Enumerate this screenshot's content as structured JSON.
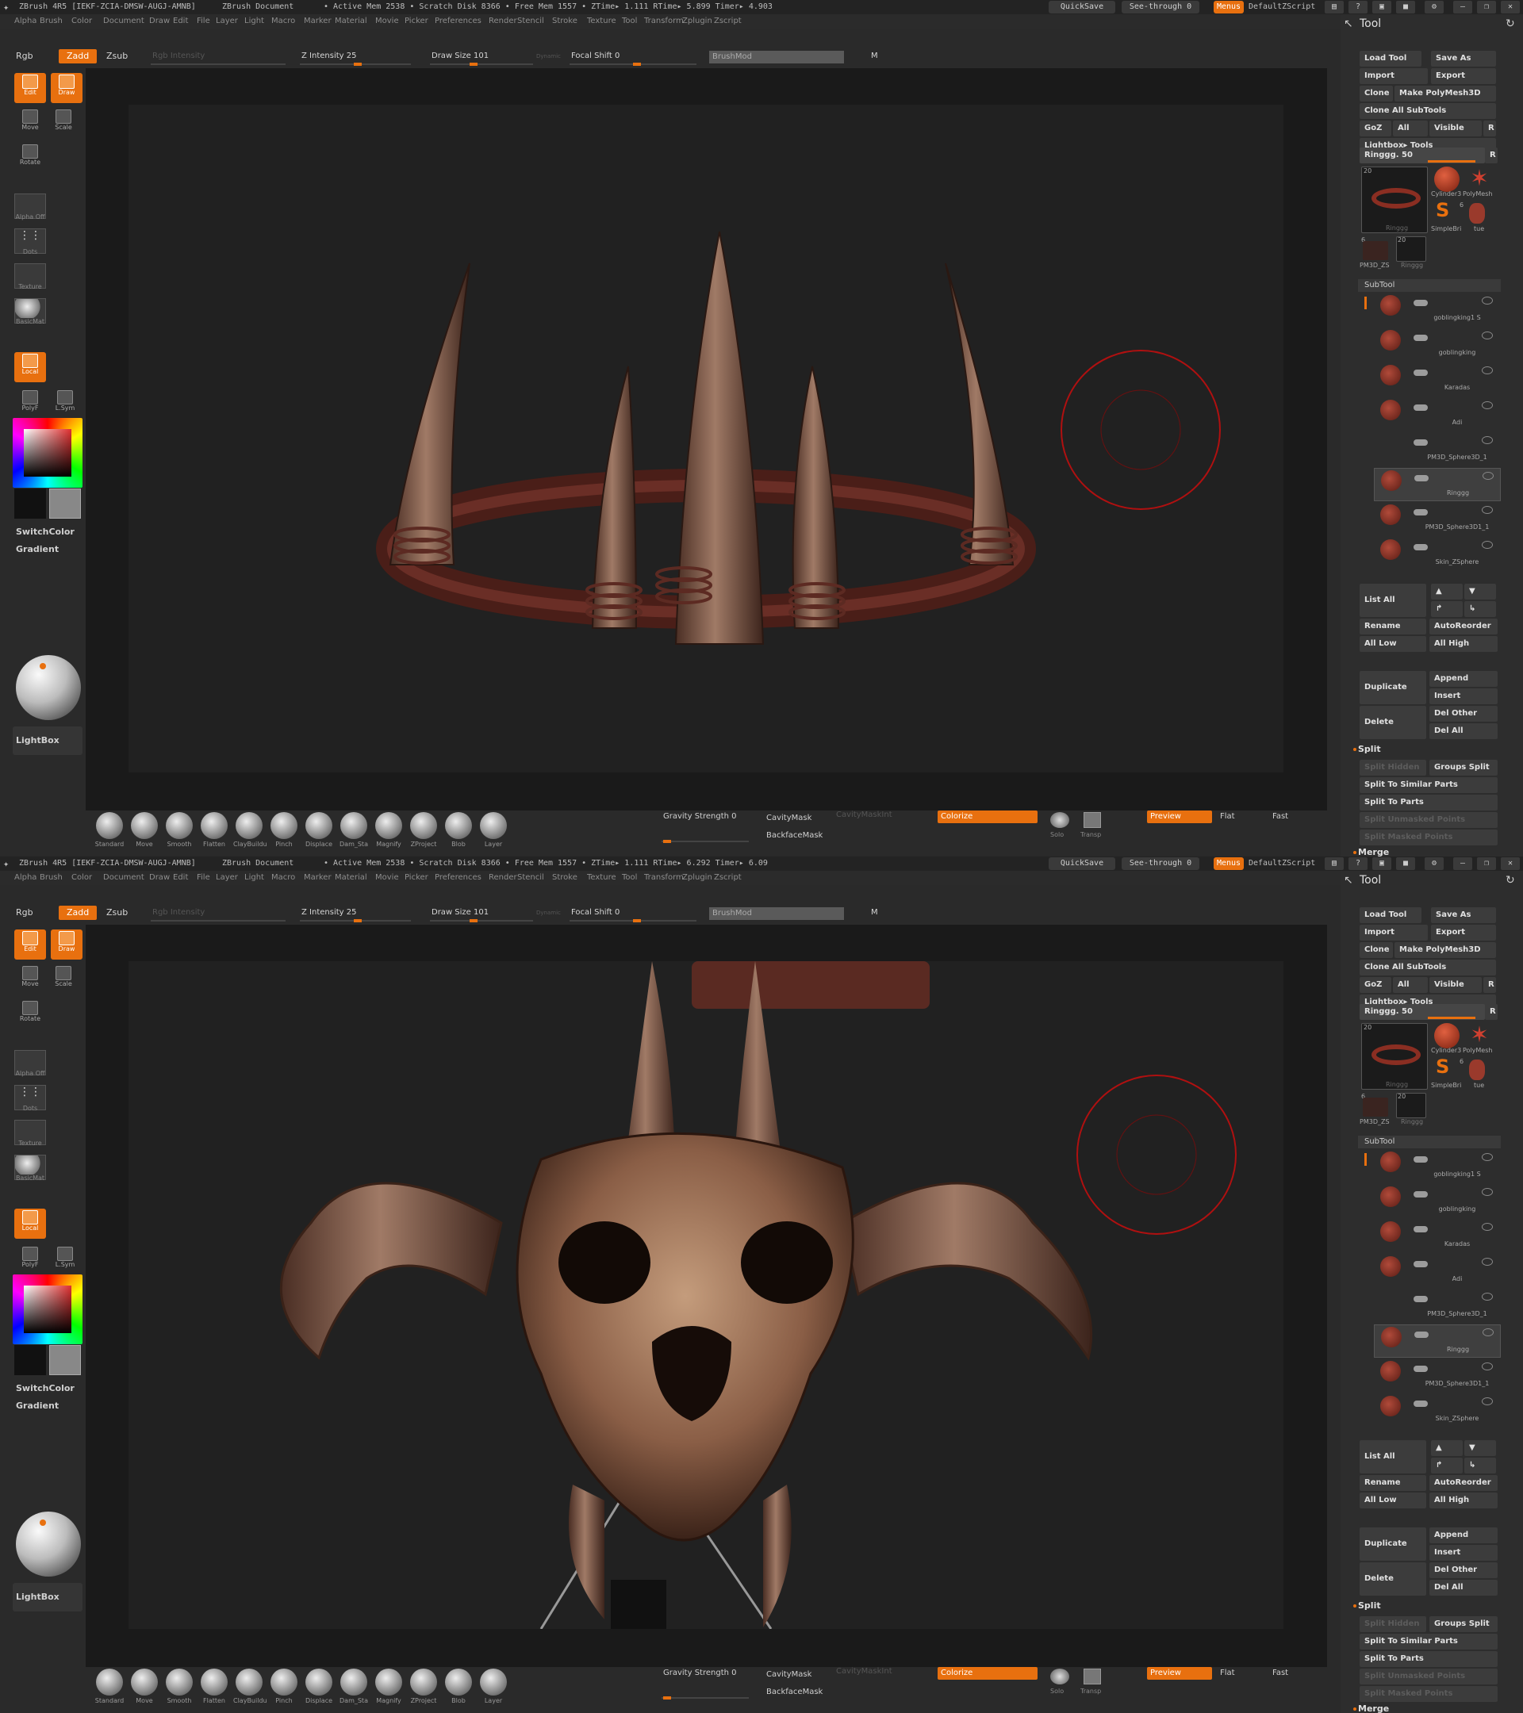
{
  "app": {
    "title_left": "ZBrush  4R5  [IEKF-ZCIA-DMSW-AUGJ-AMNB]",
    "doc": "ZBrush Document",
    "stats_top": "• Active Mem 2538 • Scratch Disk 8366 • Free Mem 1557 • ZTime▸ 1.111  RTime▸ 5.899  Timer▸ 4.903",
    "stats_bottom": "• Active Mem 2538 • Scratch Disk 8366 • Free Mem 1557 • ZTime▸ 1.111  RTime▸ 6.292  Timer▸ 6.09",
    "quicksave": "QuickSave",
    "see_through": "See-through  0",
    "menus": "Menus",
    "script": "DefaultZScript"
  },
  "menu": [
    "Alpha",
    "Brush",
    "Color",
    "Document",
    "Draw",
    "Edit",
    "File",
    "Layer",
    "Light",
    "Macro",
    "Marker",
    "Material",
    "Movie",
    "Picker",
    "Preferences",
    "Render",
    "Stencil",
    "Stroke",
    "Texture",
    "Tool",
    "Transform",
    "Zplugin",
    "Zscript"
  ],
  "toolbar": {
    "rgb": "Rgb",
    "zadd": "Zadd",
    "zsub": "Zsub",
    "rgb_intensity": "Rgb Intensity",
    "z_intensity": "Z Intensity 25",
    "draw_size": "Draw Size 101",
    "dynamic": "Dynamic",
    "focal_shift": "Focal Shift 0",
    "brushmod": "BrushMod",
    "m": "M"
  },
  "left": {
    "edit": "Edit",
    "draw": "Draw",
    "move": "Move",
    "scale": "Scale",
    "rotate": "Rotate",
    "alpha": "Alpha Off",
    "dots": "Dots",
    "texture": "Texture",
    "material": "BasicMat",
    "local": "Local",
    "polyf": "PolyF",
    "lsym": "L.Sym",
    "switchcolor": "SwitchColor",
    "gradient": "Gradient",
    "lightbox": "LightBox"
  },
  "brushes": [
    "Standard",
    "Move",
    "Smooth",
    "Flatten",
    "ClayBuildu",
    "Pinch",
    "Displace",
    "Dam_Sta",
    "Magnify",
    "ZProject",
    "Blob",
    "Layer"
  ],
  "bottom": {
    "gravity": "Gravity Strength 0",
    "cavitymask": "CavityMask",
    "cavitymaskint": "CavityMaskInt",
    "backfacemask": "BackfaceMask",
    "colorize": "Colorize",
    "solo": "Solo",
    "transp": "Transp",
    "preview": "Preview",
    "flat": "Flat",
    "fast": "Fast"
  },
  "tool": {
    "header": "Tool",
    "load": "Load Tool",
    "save_as": "Save As",
    "import": "Import",
    "export": "Export",
    "clone": "Clone",
    "make_polymesh": "Make PolyMesh3D",
    "clone_all": "Clone All SubTools",
    "goz": "GoZ",
    "all": "All",
    "visible": "Visible",
    "r": "R",
    "lightbox_tools": "Lightbox▸ Tools",
    "current": "Ringgg. 50",
    "thumb_count_a": "20",
    "thumb_name_main": "Ringgg",
    "thumb_cyl": "Cylinder3",
    "thumb_poly": "PolyMesh",
    "thumb_simple": "SimpleBri",
    "thumb_tue": "tue",
    "thumb_pm": "PM3D_ZS",
    "thumb_ring2": "Ringgg",
    "count6": "6",
    "count20": "20"
  },
  "subtool": {
    "header": "SubTool",
    "items": [
      "goblingking1 S",
      "goblingking",
      "Karadas",
      "Adi",
      "PM3D_Sphere3D_1",
      "Ringgg",
      "PM3D_Sphere3D1_1",
      "Skin_ZSphere"
    ],
    "list_all": "List  All",
    "rename": "Rename",
    "autoreorder": "AutoReorder",
    "all_low": "All  Low",
    "all_high": "All  High",
    "append": "Append",
    "duplicate": "Duplicate",
    "insert": "Insert",
    "delete": "Delete",
    "del_other": "Del  Other",
    "del_all": "Del  All",
    "split": "Split",
    "split_hidden": "Split  Hidden",
    "groups_split": "Groups  Split",
    "split_similar": "Split  To  Similar  Parts",
    "split_parts": "Split  To  Parts",
    "split_unmasked": "Split  Unmasked  Points",
    "split_masked": "Split  Masked  Points",
    "merge": "Merge"
  },
  "colors": {
    "accent": "#e8700f",
    "panel": "#2d2d2d",
    "canvas": "#212121"
  }
}
